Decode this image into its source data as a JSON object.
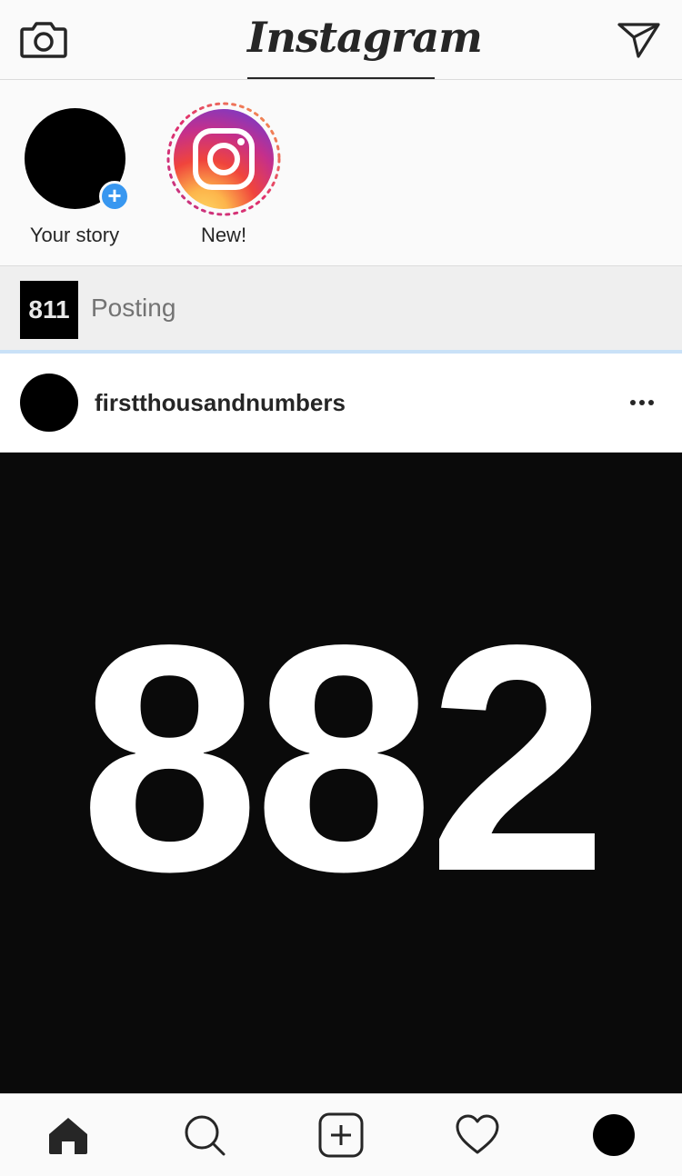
{
  "header": {
    "logo_text": "Instagram",
    "camera_icon": "camera-icon",
    "direct_icon": "paper-plane-icon"
  },
  "stories": [
    {
      "label": "Your story",
      "badge_icon": "plus-icon"
    },
    {
      "label": "New!",
      "icon": "instagram-logo-icon"
    }
  ],
  "posting": {
    "thumbnail_text": "811",
    "status_text": "Posting",
    "progress_color": "#c9e1f7"
  },
  "post": {
    "username": "firstthousandnumbers",
    "image_text": "882",
    "more_icon": "more-options-icon"
  },
  "bottom_nav": {
    "items": [
      "home-icon",
      "search-icon",
      "new-post-icon",
      "activity-heart-icon",
      "profile-avatar"
    ]
  },
  "colors": {
    "accent_blue": "#3897f0",
    "text_primary": "#262626",
    "text_secondary": "#737373"
  }
}
